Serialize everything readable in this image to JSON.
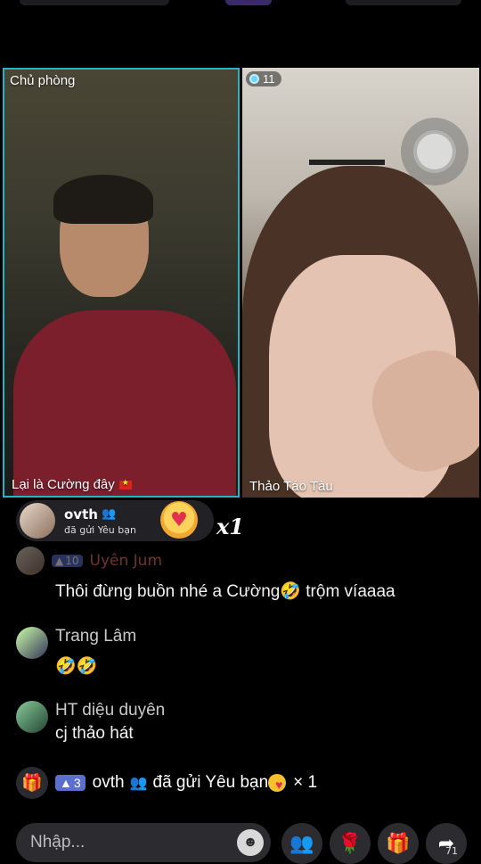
{
  "host_tile": {
    "role_label": "Chủ phòng",
    "name": "Lại là Cường đây",
    "flag_icon": "vietnam-flag-icon"
  },
  "guest_tile": {
    "viewer_count": "11",
    "name": "Thảo Táo Tàu"
  },
  "gift_toast": {
    "user": "ovth",
    "subtitle": "đã gửi Yêu bạn",
    "count": "x1",
    "gift_icon": "love-you-heart-icon"
  },
  "chat": {
    "faded_row": {
      "level": "10",
      "name": "Uyên Jum"
    },
    "messages": [
      {
        "name": "",
        "text": "Thôi đừng buồn nhé a Cường🤣 trộm víaaaa"
      },
      {
        "name": "Trang Lâm",
        "text": "🤣🤣"
      },
      {
        "name": "HT diệu duyên",
        "text": "cj thảo hát"
      }
    ],
    "gift_line": {
      "level": "3",
      "user": "ovth",
      "action": "đã gửi Yêu bạn",
      "count": "× 1"
    }
  },
  "bottom_bar": {
    "input_placeholder": "Nhập...",
    "share_count": "71"
  },
  "colors": {
    "host_border": "#1fb6c8",
    "background": "#000000",
    "level_badge": "#5b6fd0"
  }
}
